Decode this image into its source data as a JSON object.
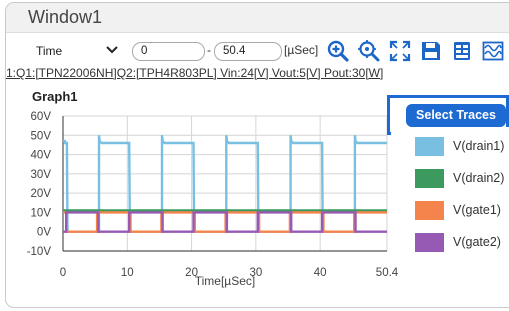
{
  "window": {
    "title": "Window1"
  },
  "toolbar": {
    "axis_select": "Time",
    "range_start": "0",
    "range_end": "50.4",
    "range_separator": "-",
    "unit": "[µSec]",
    "icons": [
      "zoom-in-icon",
      "zoom-fit-icon",
      "fullscreen-icon",
      "save-icon",
      "settings-icon",
      "waveform-icon"
    ]
  },
  "info_line": "1:Q1:[TPN22006NH]Q2:[TPH4R803PL] Vin:24[V]  Vout:5[V]  Pout:30[W]",
  "graph": {
    "title": "Graph1"
  },
  "select_traces_label": "Select Traces",
  "legend": [
    {
      "label": "V(drain1)",
      "color": "#78bfe2"
    },
    {
      "label": "V(drain2)",
      "color": "#3c9a5f"
    },
    {
      "label": "V(gate1)",
      "color": "#f5844c"
    },
    {
      "label": "V(gate2)",
      "color": "#9659b4"
    }
  ],
  "chart_data": {
    "type": "line",
    "xlabel": "Time[µSec]",
    "ylabel": "",
    "xlim": [
      0,
      50.4
    ],
    "ylim": [
      -10,
      60
    ],
    "x_ticks": [
      0,
      10,
      20,
      30,
      40,
      50.4
    ],
    "x_tick_labels": [
      "0",
      "10",
      "20",
      "30",
      "40",
      "50.4"
    ],
    "y_ticks": [
      -10,
      0,
      10,
      20,
      30,
      40,
      50,
      60
    ],
    "y_tick_labels": [
      "-10V",
      "0V",
      "10V",
      "20V",
      "30V",
      "40V",
      "50V",
      "60V"
    ],
    "grid": true,
    "series": [
      {
        "name": "V(drain1)",
        "color": "#78bfe2",
        "x": [
          0.0,
          0.3,
          0.3,
          0.6,
          0.7,
          1.0,
          5.5,
          5.6,
          5.6,
          5.7,
          6.0,
          10.3,
          10.4,
          10.6,
          15.3,
          15.4,
          15.4,
          15.5,
          15.8,
          20.3,
          20.4,
          20.6,
          25.3,
          25.4,
          25.4,
          25.5,
          25.8,
          30.3,
          30.4,
          30.6,
          35.3,
          35.4,
          35.4,
          35.5,
          35.8,
          40.3,
          40.4,
          40.6,
          45.3,
          45.4,
          45.4,
          45.5,
          45.8,
          50.4
        ],
        "y": [
          47,
          47,
          46,
          46,
          0,
          0,
          0,
          0,
          50,
          47,
          46,
          46,
          0,
          0,
          0,
          0,
          50,
          47,
          46,
          46,
          0,
          0,
          0,
          0,
          50,
          47,
          46,
          46,
          0,
          0,
          0,
          0,
          50,
          47,
          46,
          46,
          0,
          0,
          0,
          0,
          50,
          47,
          46,
          46
        ]
      },
      {
        "name": "V(drain2)",
        "color": "#3c9a5f",
        "x": [
          0,
          50.4
        ],
        "y": [
          11,
          11
        ]
      },
      {
        "name": "V(gate1)",
        "color": "#f5844c",
        "x": [
          0,
          0.5,
          0.5,
          5.3,
          5.3,
          10.5,
          10.5,
          15.3,
          15.3,
          20.5,
          20.5,
          25.3,
          25.3,
          30.5,
          30.5,
          35.3,
          35.3,
          40.5,
          40.5,
          45.3,
          45.3,
          50.4
        ],
        "y": [
          10,
          10,
          0,
          0,
          10,
          10,
          0,
          0,
          10,
          10,
          0,
          0,
          10,
          10,
          0,
          0,
          10,
          10,
          0,
          0,
          10,
          10
        ]
      },
      {
        "name": "V(gate2)",
        "color": "#9659b4",
        "x": [
          0,
          0.5,
          0.5,
          5.5,
          5.5,
          10.3,
          10.3,
          15.5,
          15.5,
          20.3,
          20.3,
          25.5,
          25.5,
          30.3,
          30.3,
          35.5,
          35.5,
          40.3,
          40.3,
          45.5,
          45.5,
          50.4
        ],
        "y": [
          0,
          0,
          10,
          10,
          0,
          0,
          10,
          10,
          0,
          0,
          10,
          10,
          0,
          0,
          10,
          10,
          0,
          0,
          10,
          10,
          0,
          0
        ]
      }
    ]
  }
}
